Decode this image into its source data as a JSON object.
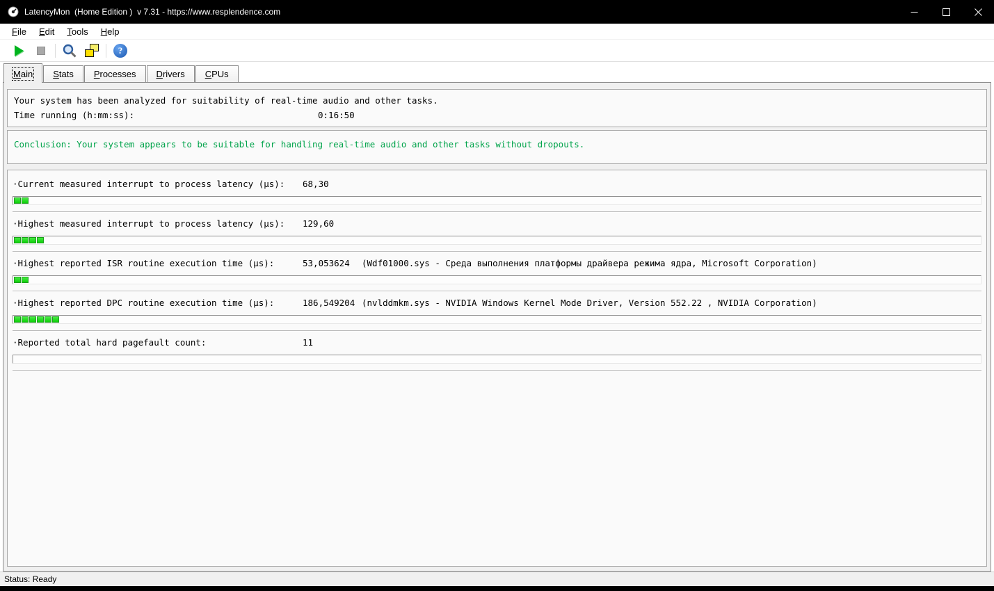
{
  "window": {
    "title": "LatencyMon  (Home Edition )  v 7.31 - https://www.resplendence.com"
  },
  "menu": {
    "items": [
      {
        "label": "File"
      },
      {
        "label": "Edit"
      },
      {
        "label": "Tools"
      },
      {
        "label": "Help"
      }
    ]
  },
  "toolbar": {
    "help_glyph": "?",
    "icons": [
      "play-icon",
      "stop-icon",
      "tools-icon",
      "copy-windows-icon",
      "help-icon"
    ]
  },
  "tabs": [
    {
      "label": "Main",
      "active": true
    },
    {
      "label": "Stats",
      "active": false
    },
    {
      "label": "Processes",
      "active": false
    },
    {
      "label": "Drivers",
      "active": false
    },
    {
      "label": "CPUs",
      "active": false
    }
  ],
  "analysis": {
    "line1": "Your system has been analyzed for suitability of real-time audio and other tasks.",
    "time_label": "Time running (h:mm:ss):",
    "time_value": "0:16:50"
  },
  "conclusion": "Conclusion: Your system appears to be suitable for handling real-time audio and other tasks without dropouts.",
  "metrics": [
    {
      "label": "·Current measured interrupt to process latency (µs):",
      "value": "68,30",
      "info": "",
      "segments": 2
    },
    {
      "label": "·Highest measured interrupt to process latency (µs):",
      "value": "129,60",
      "info": "",
      "segments": 4
    },
    {
      "label": "·Highest reported ISR routine execution time (µs):",
      "value": "53,053624",
      "info": "(Wdf01000.sys - Среда выполнения платформы драйвера режима ядра, Microsoft Corporation)",
      "segments": 2
    },
    {
      "label": "·Highest reported DPC routine execution time (µs):",
      "value": "186,549204",
      "info": "(nvlddmkm.sys - NVIDIA Windows Kernel Mode Driver, Version 552.22 , NVIDIA Corporation)",
      "segments": 6
    },
    {
      "label": "·Reported total hard pagefault count:",
      "value": "11",
      "info": "",
      "segments": 0
    }
  ],
  "status_bar": {
    "text": "Status: Ready"
  },
  "colors": {
    "titlebar_black": "#000000",
    "conclusion_green": "#00a34a",
    "meter_green": "#21dd21",
    "play_green": "#00b41e",
    "help_blue": "#1a57b0",
    "copy_yellow": "#ffe000"
  }
}
